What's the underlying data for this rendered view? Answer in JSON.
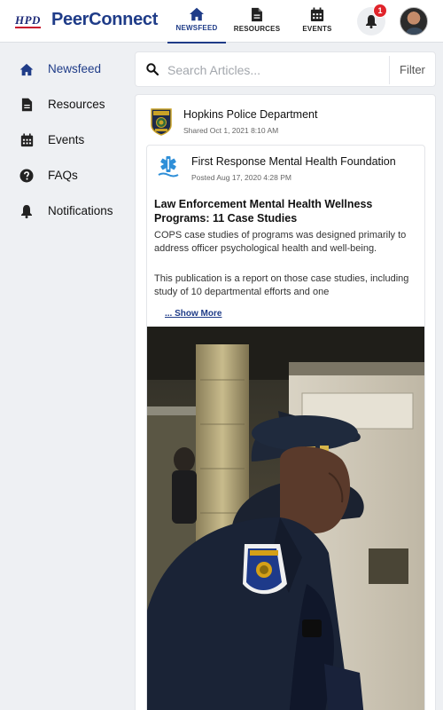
{
  "header": {
    "logo_text": "HPD",
    "brand": "PeerConnect",
    "tabs": [
      {
        "label": "NEWSFEED",
        "icon": "home-icon",
        "active": true
      },
      {
        "label": "RESOURCES",
        "icon": "document-icon",
        "active": false
      },
      {
        "label": "EVENTS",
        "icon": "calendar-icon",
        "active": false
      }
    ],
    "notification_count": "1",
    "accent_color": "#1f3c88",
    "badge_color": "#e0242b"
  },
  "sidebar": {
    "items": [
      {
        "label": "Newsfeed",
        "icon": "home-icon",
        "active": true
      },
      {
        "label": "Resources",
        "icon": "document-icon",
        "active": false
      },
      {
        "label": "Events",
        "icon": "calendar-icon",
        "active": false
      },
      {
        "label": "FAQs",
        "icon": "question-circle-icon",
        "active": false
      },
      {
        "label": "Notifications",
        "icon": "bell-icon",
        "active": false
      }
    ]
  },
  "search": {
    "placeholder": "Search Articles...",
    "filter_label": "Filter"
  },
  "post": {
    "author": "Hopkins Police Department",
    "shared": "Shared Oct 1, 2021 8:10 AM",
    "shared_item": {
      "source": "First Response Mental Health Foundation",
      "posted": "Posted Aug 17, 2020 4:28 PM",
      "title": "Law Enforcement Mental Health Wellness Programs: 11 Case Studies",
      "body_1": "COPS case studies of programs was designed primarily to address officer psychological health and well-being.",
      "body_2": "This publication is a report on those case studies, including study of 10 departmental efforts and one",
      "show_more": "... Show More"
    }
  }
}
